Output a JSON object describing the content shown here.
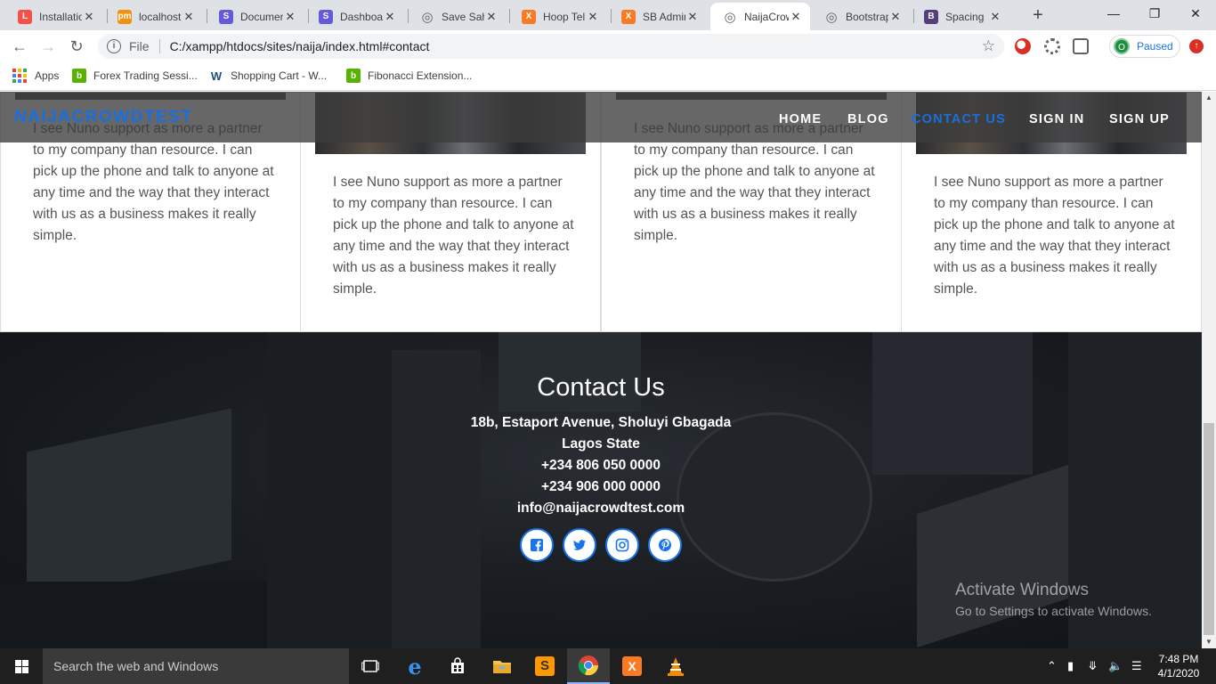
{
  "browser": {
    "tabs": [
      {
        "label": "Installatio",
        "icon": "laravel-icon",
        "color": "#f55247"
      },
      {
        "label": "localhost",
        "icon": "phpmyadmin-icon",
        "color": "#f29111"
      },
      {
        "label": "Document",
        "icon": "s-icon",
        "color": "#635bdb"
      },
      {
        "label": "Dashboard",
        "icon": "s-icon",
        "color": "#635bdb"
      },
      {
        "label": "Save Sah",
        "icon": "globe-icon",
        "color": "#5f6368"
      },
      {
        "label": "Hoop Tel",
        "icon": "xampp-icon",
        "color": "#fb7a24"
      },
      {
        "label": "SB Admin",
        "icon": "xampp-icon",
        "color": "#fb7a24"
      },
      {
        "label": "NaijaCrow",
        "icon": "globe-icon",
        "color": "#5f6368"
      },
      {
        "label": "Bootstrap",
        "icon": "globe-icon",
        "color": "#5f6368"
      },
      {
        "label": "Spacing",
        "icon": "bootstrap-icon",
        "color": "#563d7c"
      }
    ],
    "active_tab": 7,
    "omnibox": {
      "scheme": "File",
      "url": "C:/xampp/htdocs/sites/naija/index.html#contact"
    },
    "profile": {
      "initial": "O",
      "status": "Paused"
    },
    "bookmarks": [
      {
        "label": "Apps"
      },
      {
        "label": "Forex Trading Sessi..."
      },
      {
        "label": "Shopping Cart - W..."
      },
      {
        "label": "Fibonacci Extension..."
      }
    ]
  },
  "navbar": {
    "brand": "NAIJACROWDTEST",
    "links": [
      "HOME",
      "BLOG",
      "CONTACT US",
      "SIGN IN",
      "SIGN UP"
    ],
    "active": "CONTACT US",
    "brand_color": "#1a6fe0"
  },
  "testimonials": [
    {
      "text": "I see Nuno support as more a partner to my company than resource. I can pick up the phone and talk to anyone at any time and the way that they interact with us as a business makes it really simple."
    },
    {
      "text": "I see Nuno support as more a partner to my company than resource. I can pick up the phone and talk to anyone at any time and the way that they interact with us as a business makes it really simple."
    },
    {
      "text": "I see Nuno support as more a partner to my company than resource. I can pick up the phone and talk to anyone at any time and the way that they interact with us as a business makes it really simple."
    },
    {
      "text": "I see Nuno support as more a partner to my company than resource. I can pick up the phone and talk to anyone at any time and the way that they interact with us as a business makes it really simple."
    }
  ],
  "contact": {
    "title": "Contact Us",
    "address_line1": "18b, Estaport Avenue, Sholuyi Gbagada",
    "address_line2": "Lagos State",
    "phone1": "+234 806 050 0000",
    "phone2": "+234 906 000 0000",
    "email": "info@naijacrowdtest.com",
    "socials": [
      "facebook-icon",
      "twitter-icon",
      "instagram-icon",
      "pinterest-icon"
    ],
    "social_color": "#1a73e8"
  },
  "watermark": {
    "title": "Activate Windows",
    "subtitle": "Go to Settings to activate Windows."
  },
  "taskbar": {
    "search_placeholder": "Search the web and Windows",
    "time": "7:48 PM",
    "date": "4/1/2020"
  }
}
